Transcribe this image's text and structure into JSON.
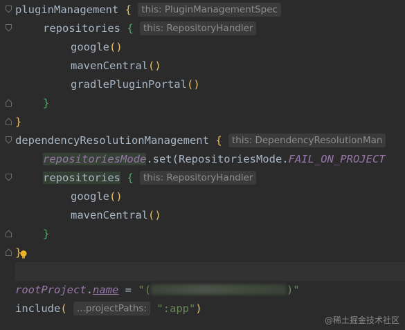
{
  "editor": {
    "lines": {
      "l1_code": "pluginManagement",
      "l1_brace": "{",
      "l1_hint": "this: PluginManagementSpec",
      "l2_code": "repositories",
      "l2_brace": "{",
      "l2_hint": "this: RepositoryHandler",
      "l3_code": "google",
      "l3_parens": "()",
      "l4_code": "mavenCentral",
      "l4_parens": "()",
      "l5_code": "gradlePluginPortal",
      "l5_parens": "()",
      "l6_brace": "}",
      "l7_brace": "}",
      "l8_code": "dependencyResolutionManagement",
      "l8_brace": "{",
      "l8_hint": "this: DependencyResolutionMan",
      "l9_prop": "repositoriesMode",
      "l9_set": ".set(",
      "l9_enum": "RepositoriesMode",
      "l9_dot": ".",
      "l9_const": "FAIL_ON_PROJECT",
      "l10_code": "repositories",
      "l10_brace": "{",
      "l10_hint": "this: RepositoryHandler",
      "l11_code": "google",
      "l11_parens": "()",
      "l12_code": "mavenCentral",
      "l12_parens": "()",
      "l13_brace": "}",
      "l14_brace": "}",
      "l16_obj": "rootProject",
      "l16_dot": ".",
      "l16_prop": "name",
      "l16_eq": " = ",
      "l16_str_open": "\"(",
      "l16_str_close": ")\"",
      "l17_code": "include",
      "l17_paren_open": "(",
      "l17_hint": "...projectPaths:",
      "l17_str": "\":app\"",
      "l17_paren_close": ")"
    }
  },
  "watermark": "@稀土掘金技术社区",
  "icons": {
    "fold_marker": "fold-marker-icon",
    "intention_bulb": "lightbulb-icon"
  },
  "colors": {
    "background": "#2b2b2b",
    "current_line": "#323232",
    "text": "#a9b7c6",
    "property": "#9876aa",
    "string": "#6a8759",
    "brace_match": "#e8bf6a",
    "hint_text": "#8c8c8c",
    "hint_bg": "#3b3b3b"
  }
}
